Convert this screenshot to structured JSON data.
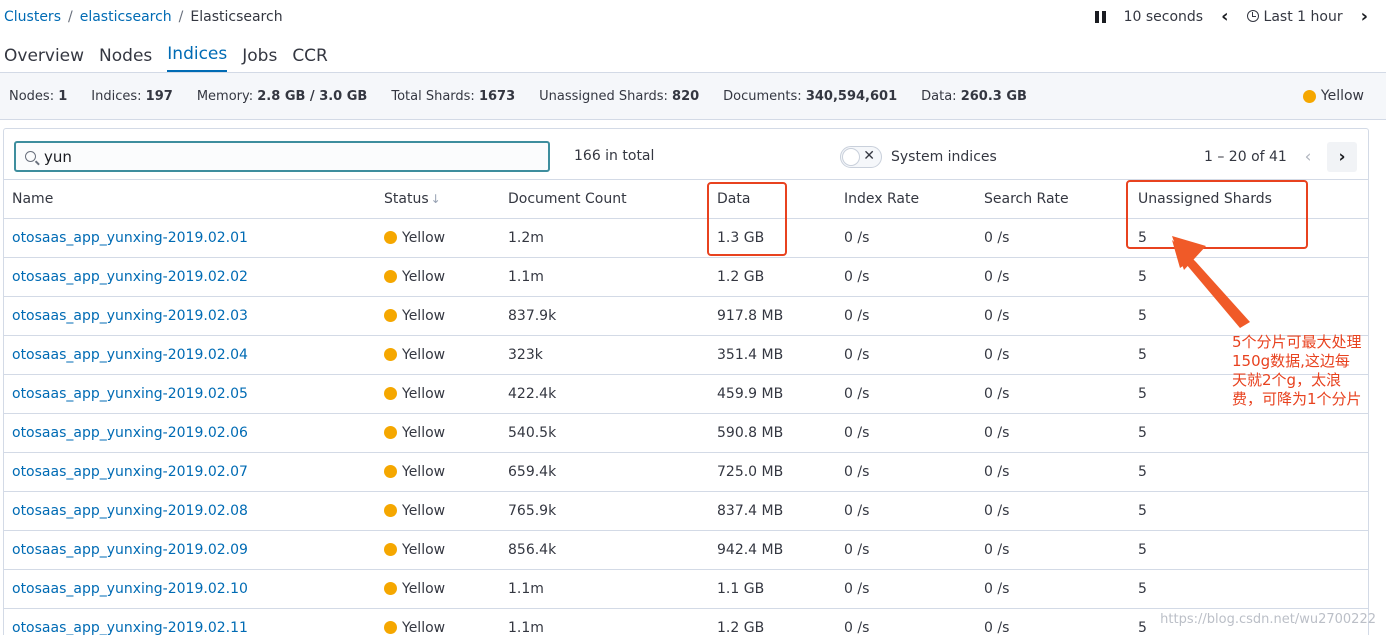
{
  "breadcrumb": {
    "clusters": "Clusters",
    "cluster": "elasticsearch",
    "current": "Elasticsearch",
    "sep": "/"
  },
  "time": {
    "interval": "10 seconds",
    "range": "Last 1 hour"
  },
  "tabs": [
    "Overview",
    "Nodes",
    "Indices",
    "Jobs",
    "CCR"
  ],
  "active_tab": "Indices",
  "stats": {
    "nodes_label": "Nodes:",
    "nodes": "1",
    "indices_label": "Indices:",
    "indices": "197",
    "memory_label": "Memory:",
    "memory": "2.8 GB / 3.0 GB",
    "shards_label": "Total Shards:",
    "shards": "1673",
    "unassigned_label": "Unassigned Shards:",
    "unassigned": "820",
    "documents_label": "Documents:",
    "documents": "340,594,601",
    "data_label": "Data:",
    "data": "260.3 GB",
    "health": "Yellow"
  },
  "search": {
    "value": "yun"
  },
  "total": "166 in total",
  "system_indices_label": "System indices",
  "pager": "1 – 20 of 41",
  "columns": [
    "Name",
    "Status",
    "Document Count",
    "Data",
    "Index Rate",
    "Search Rate",
    "Unassigned Shards"
  ],
  "rows": [
    {
      "name": "otosaas_app_yunxing-2019.02.01",
      "status": "Yellow",
      "docs": "1.2m",
      "data": "1.3 GB",
      "index_rate": "0 /s",
      "search_rate": "0 /s",
      "unassigned": "5"
    },
    {
      "name": "otosaas_app_yunxing-2019.02.02",
      "status": "Yellow",
      "docs": "1.1m",
      "data": "1.2 GB",
      "index_rate": "0 /s",
      "search_rate": "0 /s",
      "unassigned": "5"
    },
    {
      "name": "otosaas_app_yunxing-2019.02.03",
      "status": "Yellow",
      "docs": "837.9k",
      "data": "917.8 MB",
      "index_rate": "0 /s",
      "search_rate": "0 /s",
      "unassigned": "5"
    },
    {
      "name": "otosaas_app_yunxing-2019.02.04",
      "status": "Yellow",
      "docs": "323k",
      "data": "351.4 MB",
      "index_rate": "0 /s",
      "search_rate": "0 /s",
      "unassigned": "5"
    },
    {
      "name": "otosaas_app_yunxing-2019.02.05",
      "status": "Yellow",
      "docs": "422.4k",
      "data": "459.9 MB",
      "index_rate": "0 /s",
      "search_rate": "0 /s",
      "unassigned": "5"
    },
    {
      "name": "otosaas_app_yunxing-2019.02.06",
      "status": "Yellow",
      "docs": "540.5k",
      "data": "590.8 MB",
      "index_rate": "0 /s",
      "search_rate": "0 /s",
      "unassigned": "5"
    },
    {
      "name": "otosaas_app_yunxing-2019.02.07",
      "status": "Yellow",
      "docs": "659.4k",
      "data": "725.0 MB",
      "index_rate": "0 /s",
      "search_rate": "0 /s",
      "unassigned": "5"
    },
    {
      "name": "otosaas_app_yunxing-2019.02.08",
      "status": "Yellow",
      "docs": "765.9k",
      "data": "837.4 MB",
      "index_rate": "0 /s",
      "search_rate": "0 /s",
      "unassigned": "5"
    },
    {
      "name": "otosaas_app_yunxing-2019.02.09",
      "status": "Yellow",
      "docs": "856.4k",
      "data": "942.4 MB",
      "index_rate": "0 /s",
      "search_rate": "0 /s",
      "unassigned": "5"
    },
    {
      "name": "otosaas_app_yunxing-2019.02.10",
      "status": "Yellow",
      "docs": "1.1m",
      "data": "1.1 GB",
      "index_rate": "0 /s",
      "search_rate": "0 /s",
      "unassigned": "5"
    },
    {
      "name": "otosaas_app_yunxing-2019.02.11",
      "status": "Yellow",
      "docs": "1.1m",
      "data": "1.2 GB",
      "index_rate": "0 /s",
      "search_rate": "0 /s",
      "unassigned": "5"
    }
  ],
  "annotation": "5个分片可最大处理150g数据,这边每天就2个g，太浪费，可降为1个分片",
  "watermark": "https://blog.csdn.net/wu2700222",
  "colors": {
    "link": "#006bb4",
    "yellow_status": "#f5a700",
    "annotation": "#e8421f"
  }
}
